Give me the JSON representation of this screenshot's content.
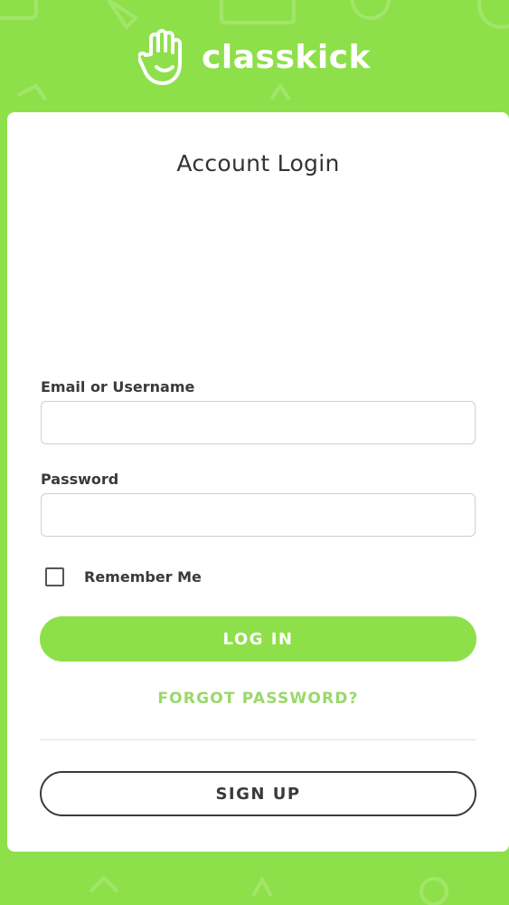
{
  "brand": {
    "name": "classkick",
    "logo_icon": "raised-hand-smiley-icon"
  },
  "colors": {
    "brand_green": "#8ee04a",
    "link_green": "#9ad86a",
    "card_bg": "#ffffff",
    "text_dark": "#3a3a3a"
  },
  "login": {
    "title": "Account Login",
    "email_label": "Email or Username",
    "email_value": "",
    "password_label": "Password",
    "password_value": "",
    "remember_label": "Remember Me",
    "remember_checked": false,
    "login_button": "LOG IN",
    "forgot_link": "FORGOT PASSWORD?",
    "signup_button": "SIGN UP"
  }
}
